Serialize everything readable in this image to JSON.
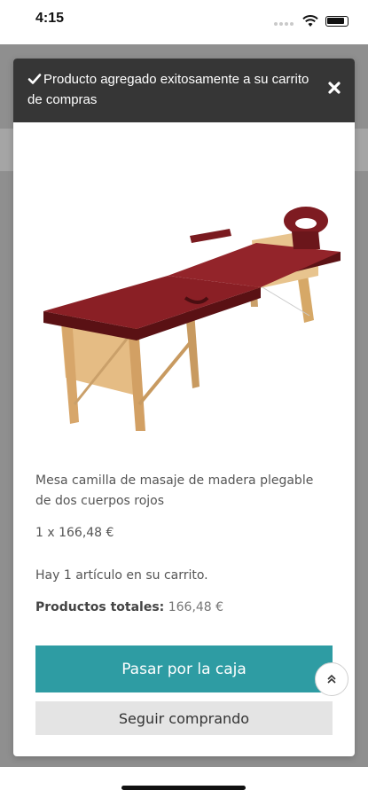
{
  "status_bar": {
    "time": "4:15"
  },
  "notification": {
    "message": "Producto agregado exitosamente a su carrito de compras"
  },
  "product": {
    "name": "Mesa camilla de masaje de madera plegable de dos cuerpos rojos",
    "quantity_price": "1 x 166,48 €",
    "image_alt": "Red folding wooden massage table"
  },
  "cart": {
    "count_text": "Hay 1 artículo en su carrito.",
    "total_label": "Productos totales:",
    "total_value": "166,48 €"
  },
  "buttons": {
    "checkout": "Pasar por la caja",
    "continue": "Seguir comprando"
  },
  "colors": {
    "header_bg": "#363636",
    "checkout_bg": "#2e9ca3",
    "continue_bg": "#e4e4e4",
    "overlay": "#8f8f8f"
  },
  "icons": [
    "check-icon",
    "close-icon",
    "chevron-up-icon",
    "wifi-icon",
    "battery-icon",
    "signal-icon"
  ]
}
